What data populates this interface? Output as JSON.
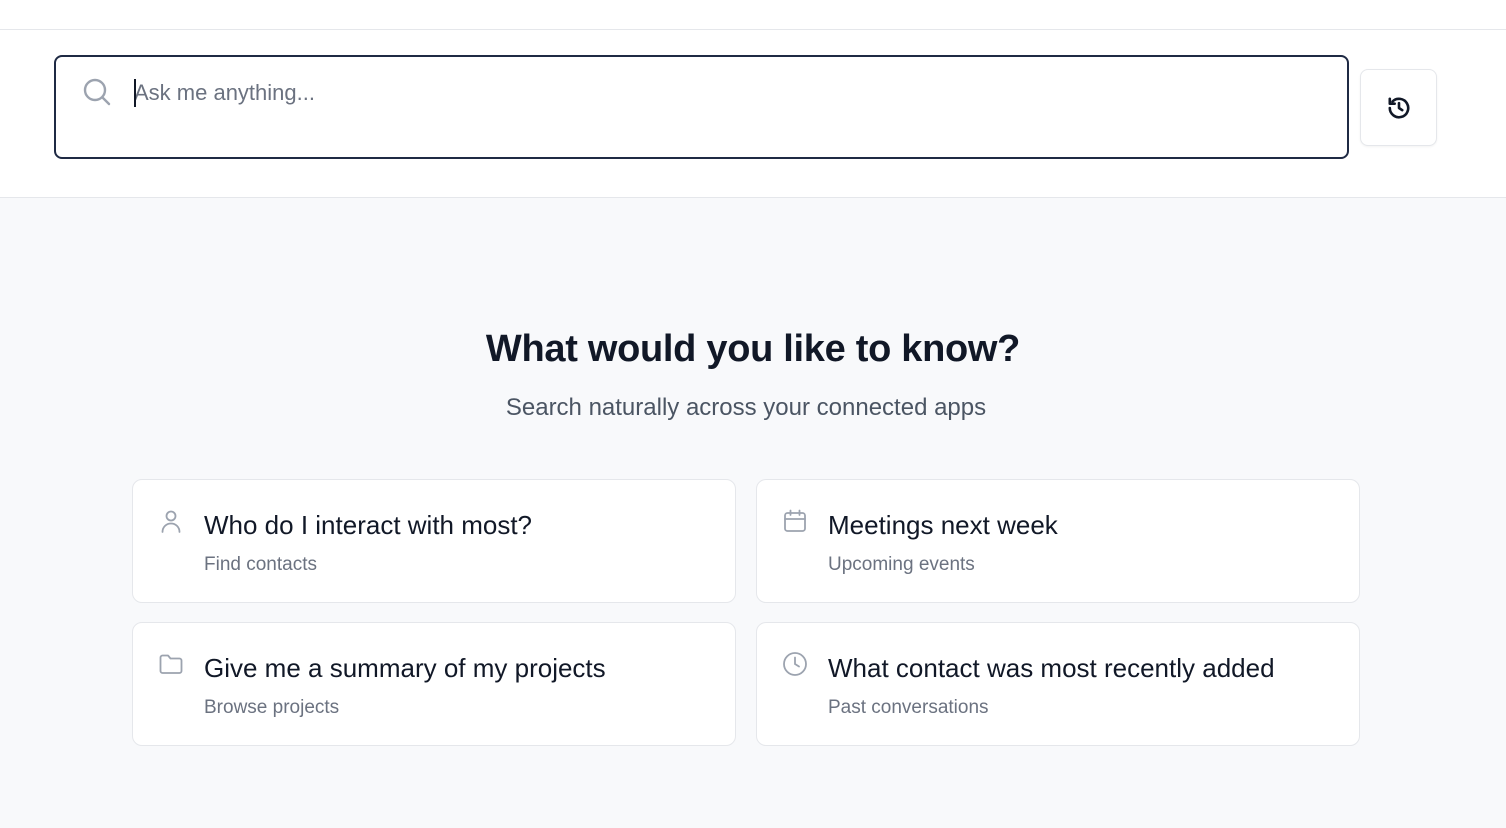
{
  "search": {
    "placeholder": "Ask me anything...",
    "value": "",
    "icon": "search-icon"
  },
  "history_button": {
    "icon": "history-icon"
  },
  "hero": {
    "title": "What would you like to know?",
    "subtitle": "Search naturally across your connected apps"
  },
  "suggestions": [
    {
      "title": "Who do I interact with most?",
      "subtitle": "Find contacts",
      "icon": "person-icon"
    },
    {
      "title": "Meetings next week",
      "subtitle": "Upcoming events",
      "icon": "calendar-icon"
    },
    {
      "title": "Give me a summary of my projects",
      "subtitle": "Browse projects",
      "icon": "folder-icon"
    },
    {
      "title": "What contact was most recently added",
      "subtitle": "Past conversations",
      "icon": "clock-icon"
    }
  ],
  "colors": {
    "focus_border": "#1f2a44",
    "page_background": "#f8f9fb",
    "card_border": "#e5e7eb",
    "muted_text": "#6b7280"
  }
}
